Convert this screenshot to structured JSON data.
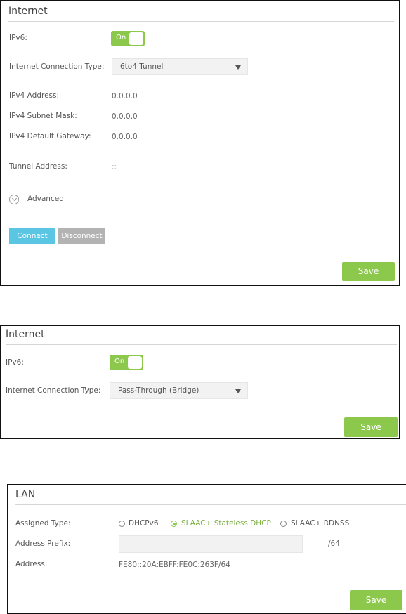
{
  "panel1": {
    "title": "Internet",
    "ipv6_label": "IPv6:",
    "ipv6_toggle": "On",
    "conn_type_label": "Internet Connection Type:",
    "conn_type_value": "6to4 Tunnel",
    "ipv4_address_label": "IPv4 Address:",
    "ipv4_address_value": "0.0.0.0",
    "ipv4_mask_label": "IPv4 Subnet Mask:",
    "ipv4_mask_value": "0.0.0.0",
    "ipv4_gateway_label": "IPv4 Default Gateway:",
    "ipv4_gateway_value": "0.0.0.0",
    "tunnel_address_label": "Tunnel Address:",
    "tunnel_address_value": "::",
    "advanced_label": "Advanced",
    "connect_label": "Connect",
    "disconnect_label": "Disconnect",
    "save_label": "Save"
  },
  "panel2": {
    "title": "Internet",
    "ipv6_label": "IPv6:",
    "ipv6_toggle": "On",
    "conn_type_label": "Internet Connection Type:",
    "conn_type_value": "Pass-Through (Bridge)",
    "save_label": "Save"
  },
  "panel3": {
    "title": "LAN",
    "assigned_type_label": "Assigned Type:",
    "assigned_options": [
      {
        "label": "DHCPv6",
        "checked": false
      },
      {
        "label": "SLAAC+ Stateless DHCP",
        "checked": true
      },
      {
        "label": "SLAAC+ RDNSS",
        "checked": false
      }
    ],
    "address_prefix_label": "Address Prefix:",
    "address_prefix_value": "",
    "address_prefix_suffix": "/64",
    "address_label": "Address:",
    "address_value": "FE80::20A:EBFF:FE0C:263F/64",
    "save_label": "Save"
  },
  "colors": {
    "accent_green": "#8cc84b",
    "connect_blue": "#5bc5e4",
    "disabled_gray": "#b3b3b3"
  }
}
